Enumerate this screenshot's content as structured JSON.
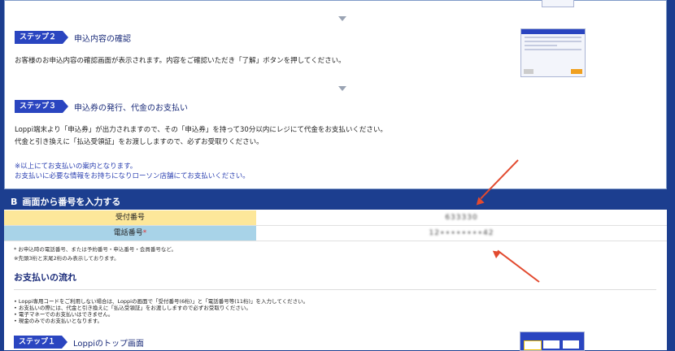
{
  "step2": {
    "badge": "ステップ２",
    "title": "申込内容の確認",
    "desc": "お客様のお申込内容の確認画面が表示されます。内容をご確認いただき「了解」ボタンを押してください。"
  },
  "step3": {
    "badge": "ステップ３",
    "title": "申込券の発行、代金のお支払い",
    "desc1": "Loppi端末より「申込券」が出力されますので、その「申込券」を持って30分以内にレジにて代金をお支払いください。",
    "desc2": "代金と引き換えに「払込受領証」をお渡ししますので、必ずお受取りください。"
  },
  "notice": {
    "line1": "※以上にてお支払いの案内となります。",
    "line2": "お支払いに必要な情報をお持ちになりローソン店舗にてお支払いください。"
  },
  "sectionB": {
    "letter": "B",
    "title": "画面から番号を入力する",
    "rows": [
      {
        "label": "受付番号",
        "value": "633330"
      },
      {
        "label": "電話番号",
        "required": "*",
        "value": "12∙∙∙∙∙∙∙∙42"
      }
    ],
    "note1": "* お申込時の電話番号、または予約番号・申込番号・会員番号など。",
    "note2": "※先頭3桁と末尾2桁のみ表示しております。"
  },
  "flow": {
    "title": "お支払いの流れ",
    "items": [
      "Loppi専用コードをご利用しない場合は、Loppiの画面で「受付番号(6桁)」と「電話番号等(11桁)」を入力してください。",
      "お支払いの際には、代金と引き換えに「払込受領証」をお渡ししますので必ずお受取りください。",
      "電子マネーでのお支払いはできません。",
      "現金のみでのお支払いとなります。"
    ]
  },
  "step1": {
    "badge": "ステップ１",
    "title": "Loppiのトップ画面"
  },
  "colors": {
    "navy": "#1c3e8f",
    "badge": "#2a45c0",
    "yellow_label": "#fde79a",
    "blue_label": "#a8d3e8",
    "arrow": "#e24a2f"
  }
}
